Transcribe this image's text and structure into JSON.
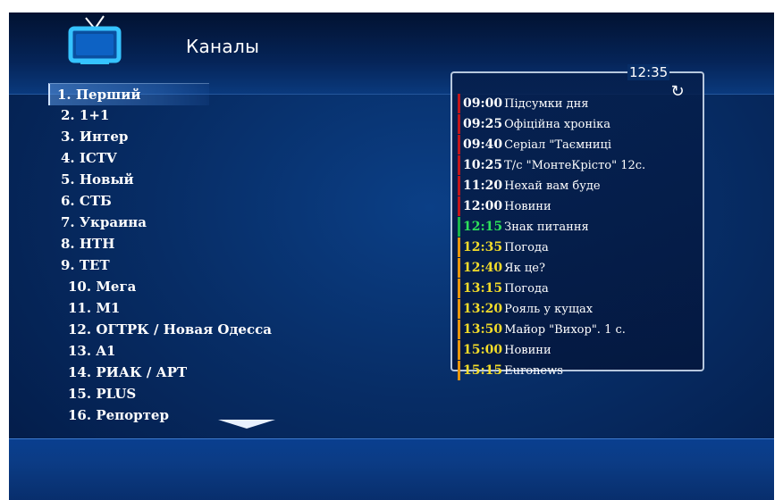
{
  "header": {
    "title": "Каналы",
    "icon": "tv-icon"
  },
  "channels": [
    {
      "label": "1.  Перший",
      "selected": true
    },
    {
      "label": "2.  1+1"
    },
    {
      "label": "3.  Интер"
    },
    {
      "label": "4.  ICTV"
    },
    {
      "label": "5.  Новый"
    },
    {
      "label": "6.  СТБ"
    },
    {
      "label": "7.  Украина"
    },
    {
      "label": "8.  НТН"
    },
    {
      "label": "9.  ТЕТ"
    },
    {
      "label": "10.  Мега"
    },
    {
      "label": "11.  M1"
    },
    {
      "label": "12.  ОГТРК / Новая Одесса"
    },
    {
      "label": "13.  A1"
    },
    {
      "label": "14.  РИАК / АРТ"
    },
    {
      "label": "15.  PLUS"
    },
    {
      "label": "16.  Репортер"
    }
  ],
  "epg": {
    "clock": "12:35",
    "items": [
      {
        "time": "09:00",
        "title": "Підсумки дня",
        "status": "past"
      },
      {
        "time": "09:25",
        "title": "Офіційна хроніка",
        "status": "past"
      },
      {
        "time": "09:40",
        "title": "Серіал \"Таємниці",
        "status": "past"
      },
      {
        "time": "10:25",
        "title": "Т/с \"МонтеКрісто\" 12с.",
        "status": "past"
      },
      {
        "time": "11:20",
        "title": "Нехай вам буде",
        "status": "past"
      },
      {
        "time": "12:00",
        "title": "Новини",
        "status": "past"
      },
      {
        "time": "12:15",
        "title": "Знак питання",
        "status": "current"
      },
      {
        "time": "12:35",
        "title": "Погода",
        "status": "future"
      },
      {
        "time": "12:40",
        "title": "Як це?",
        "status": "future"
      },
      {
        "time": "13:15",
        "title": "Погода",
        "status": "future"
      },
      {
        "time": "13:20",
        "title": "Рояль у кущах",
        "status": "future"
      },
      {
        "time": "13:50",
        "title": "Майор \"Вихор\". 1 с.",
        "status": "future"
      },
      {
        "time": "15:00",
        "title": "Новини",
        "status": "future"
      },
      {
        "time": "15:15",
        "title": "Euronews",
        "status": "future"
      }
    ]
  },
  "colors": {
    "background": "#072d66",
    "past_marker": "#c0151b",
    "current_marker": "#1ab54a",
    "future_marker": "#e8950c",
    "future_time": "#f3dc2a",
    "current_time": "#2ee05a"
  }
}
